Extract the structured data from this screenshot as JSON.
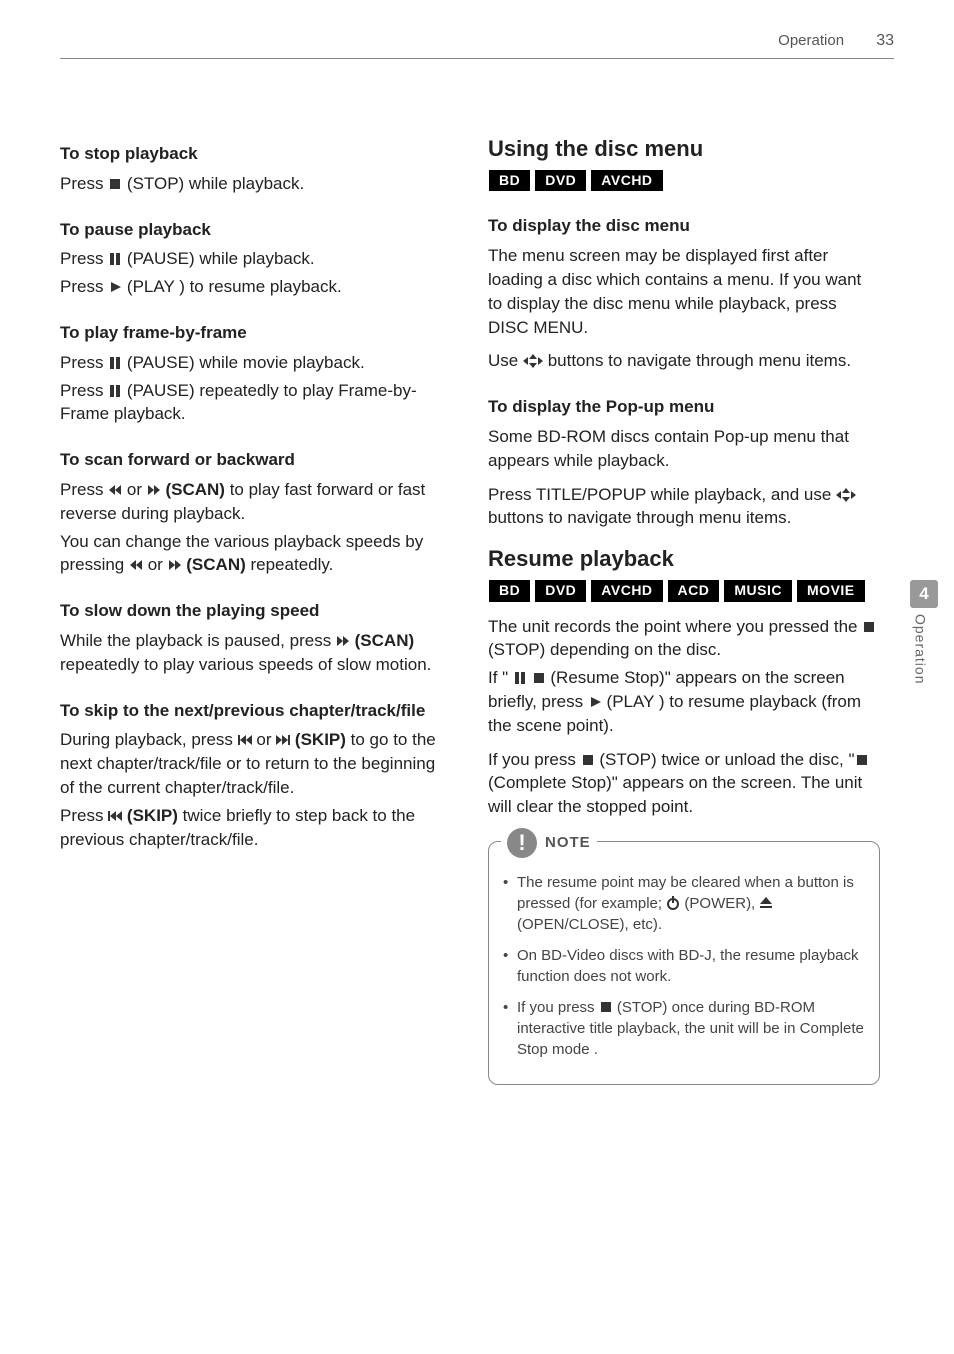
{
  "header": {
    "section": "Operation",
    "page_number": "33"
  },
  "sidetab": {
    "number": "4",
    "label": "Operation"
  },
  "left": {
    "s1": {
      "h": "To stop playback",
      "p1a": "Press ",
      "p1b": " (STOP) while playback."
    },
    "s2": {
      "h": "To pause playback",
      "p1a": "Press ",
      "p1b": " (PAUSE) while playback.",
      "p2a": "Press ",
      "p2b": " (PLAY ) to resume playback."
    },
    "s3": {
      "h": "To play frame-by-frame",
      "p1a": "Press ",
      "p1b": " (PAUSE) while movie playback.",
      "p2a": "Press ",
      "p2b": " (PAUSE) repeatedly to play Frame-by-Frame playback."
    },
    "s4": {
      "h": "To scan forward or backward",
      "p1a": "Press ",
      "p1b": " or ",
      "p1c": " (SCAN)",
      "p1d": " to play fast forward or fast reverse during playback.",
      "p2a": "You can change the various playback speeds by pressing ",
      "p2b": " or ",
      "p2c": " (SCAN)",
      "p2d": " repeatedly."
    },
    "s5": {
      "h": "To slow down the playing speed",
      "p1a": "While the playback is paused, press ",
      "p1b": " (SCAN)",
      "p1c": " repeatedly to play various speeds of slow motion."
    },
    "s6": {
      "h": "To skip to the next/previous chapter/track/file",
      "p1a": "During playback, press ",
      "p1b": " or ",
      "p1c": " (SKIP)",
      "p1d": " to go to the next chapter/track/file or to return to the beginning of the current chapter/track/file.",
      "p2a": "Press ",
      "p2b": " (SKIP)",
      "p2c": " twice briefly to step back to the previous chapter/track/file."
    }
  },
  "right": {
    "disc": {
      "h": "Using the disc menu",
      "badges": [
        "BD",
        "DVD",
        "AVCHD"
      ],
      "s1": {
        "h": "To display the disc menu",
        "p1": "The menu screen may be displayed first after loading a disc which contains a menu. If you want to display the disc menu while playback, press DISC MENU.",
        "p2a": "Use ",
        "p2b": " buttons to navigate through menu items."
      },
      "s2": {
        "h": "To display the Pop-up menu",
        "p1": "Some BD-ROM discs contain Pop-up menu that appears while playback.",
        "p2a": "Press TITLE/POPUP while playback, and use ",
        "p2b": " buttons to navigate through menu items."
      }
    },
    "resume": {
      "h": "Resume playback",
      "badges": [
        "BD",
        "DVD",
        "AVCHD",
        "ACD",
        "MUSIC",
        "MOVIE"
      ],
      "p1a": "The unit records the point where you pressed the ",
      "p1b": " (STOP) depending on the disc.",
      "p2a": "If \" ",
      "p2b": " (Resume Stop)\" appears on the screen briefly, press ",
      "p2c": " (PLAY ) to resume playback (from the scene point).",
      "p3a": "If you press ",
      "p3b": " (STOP) twice or unload the disc, \"",
      "p3c": " (Complete Stop)\" appears on the screen. The unit will clear the stopped point."
    },
    "note": {
      "label": "NOTE",
      "i1a": "The resume point may be cleared when a button is pressed (for example; ",
      "i1b": " (POWER), ",
      "i1c": " (OPEN/CLOSE), etc).",
      "i2": "On BD-Video discs with BD-J, the resume playback function does not work.",
      "i3a": "If you press ",
      "i3b": " (STOP) once during BD-ROM interactive title playback, the unit will be in Complete Stop mode ."
    }
  }
}
